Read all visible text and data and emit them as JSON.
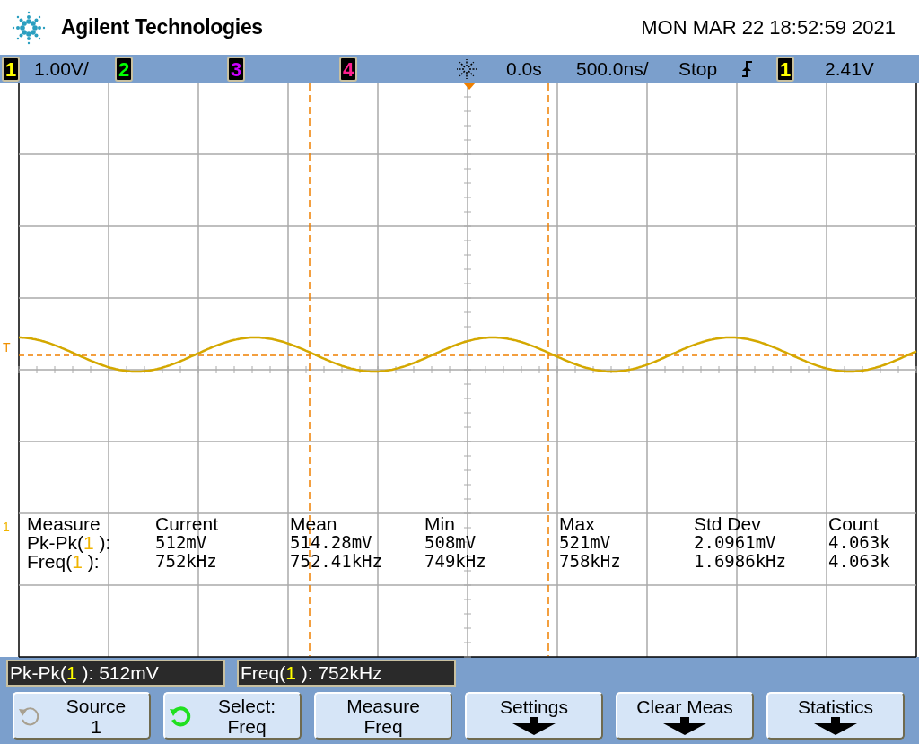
{
  "header": {
    "brand": "Agilent Technologies",
    "datetime": "MON MAR 22 18:52:59 2021"
  },
  "status_bar": {
    "channels": [
      {
        "number": "1",
        "color": "#ffff00",
        "scale": "1.00V/"
      },
      {
        "number": "2",
        "color": "#00ff00"
      },
      {
        "number": "3",
        "color": "#cc00ff"
      },
      {
        "number": "4",
        "color": "#ff1f8f"
      }
    ],
    "delay": "0.0s",
    "timebase": "500.0ns/",
    "run_state": "Stop",
    "trigger_channel": {
      "number": "1",
      "color": "#ffff00"
    },
    "trigger_level": "2.41V"
  },
  "display": {
    "trigger_marker": "T",
    "channel_marker": "1",
    "measurements": {
      "columns": [
        "Measure",
        "Current",
        "Mean",
        "Min",
        "Max",
        "Std Dev",
        "Count"
      ],
      "rows": [
        {
          "label": {
            "before": "Pk-Pk(",
            "channel": "1",
            "after": " ):"
          },
          "values": [
            "512mV",
            "514.28mV",
            "508mV",
            "521mV",
            "2.0961mV",
            "4.063k"
          ]
        },
        {
          "label": {
            "before": "Freq(",
            "channel": "1",
            "after": " ):"
          },
          "values": [
            "752kHz",
            "752.41kHz",
            "749kHz",
            "758kHz",
            "1.6986kHz",
            "4.063k"
          ]
        }
      ]
    }
  },
  "readouts": [
    {
      "before": "Pk-Pk(",
      "channel": "1",
      "after": " ): 512mV"
    },
    {
      "before": "Freq(",
      "channel": "1",
      "after": " ): 752kHz"
    }
  ],
  "softkeys": [
    {
      "kind": "knob",
      "active": false,
      "label": "Source",
      "value": "1"
    },
    {
      "kind": "knob",
      "active": true,
      "label": "Select:",
      "value": "Freq"
    },
    {
      "kind": "plain",
      "label": "Measure",
      "value": "Freq"
    },
    {
      "kind": "submenu",
      "label": "Settings"
    },
    {
      "kind": "submenu",
      "label": "Clear Meas"
    },
    {
      "kind": "submenu",
      "label": "Statistics"
    }
  ]
}
